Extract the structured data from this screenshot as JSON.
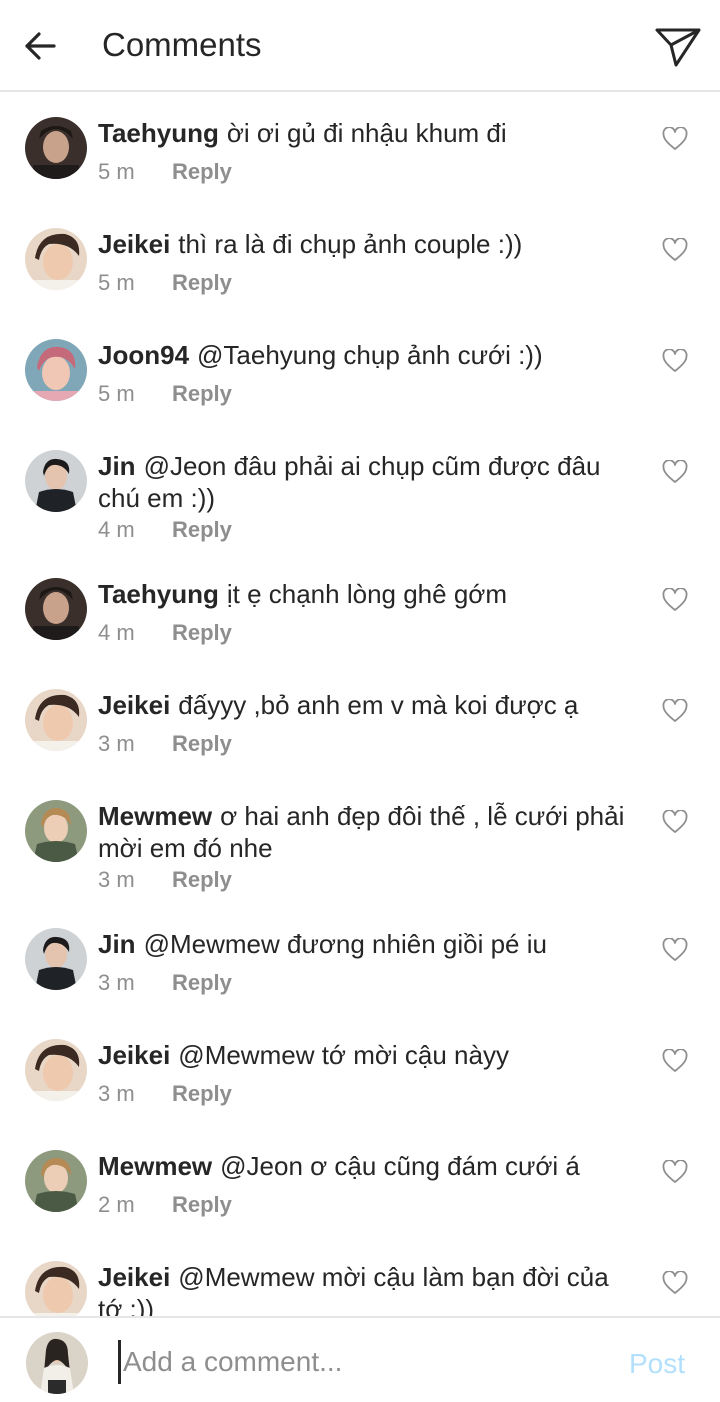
{
  "header": {
    "title": "Comments",
    "back_icon": "arrow-left-icon",
    "share_icon": "paper-plane-icon"
  },
  "colors": {
    "text": "#262626",
    "muted": "#8e8e8e",
    "divider": "#e6e6e6",
    "post_disabled": "#b2dffc"
  },
  "comments": [
    {
      "user": "Taehyung",
      "text": "ời ơi gủ đi nhậu khum đi",
      "time": "5 m",
      "reply": "Reply"
    },
    {
      "user": "Jeikei",
      "text": "thì ra là đi chụp ảnh couple :))",
      "time": "5 m",
      "reply": "Reply"
    },
    {
      "user": "Joon94",
      "text": "@Taehyung chụp ảnh cưới :))",
      "time": "5 m",
      "reply": "Reply"
    },
    {
      "user": "Jin",
      "text": "@Jeon đâu phải ai chụp cũm được đâu chú em :))",
      "time": "4 m",
      "reply": "Reply"
    },
    {
      "user": "Taehyung",
      "text": "ịt ẹ chạnh lòng ghê gớm",
      "time": "4 m",
      "reply": "Reply"
    },
    {
      "user": "Jeikei",
      "text": "đấyyy ,bỏ anh em v mà koi được ạ",
      "time": "3 m",
      "reply": "Reply"
    },
    {
      "user": "Mewmew",
      "text": "ơ hai anh đẹp đôi thế , lễ cưới phải mời em đó nhe",
      "time": "3 m",
      "reply": "Reply"
    },
    {
      "user": "Jin",
      "text": "@Mewmew đương nhiên giồi pé iu",
      "time": "3 m",
      "reply": "Reply"
    },
    {
      "user": "Jeikei",
      "text": "@Mewmew tớ mời cậu nàyy",
      "time": "3 m",
      "reply": "Reply"
    },
    {
      "user": "Mewmew",
      "text": "@Jeon ơ cậu cũng đám cưới á",
      "time": "2 m",
      "reply": "Reply"
    },
    {
      "user": "Jeikei",
      "text": "@Mewmew mời cậu làm bạn đời của tớ :))",
      "time": "",
      "reply": ""
    }
  ],
  "composer": {
    "placeholder": "Add a comment...",
    "post_label": "Post"
  }
}
